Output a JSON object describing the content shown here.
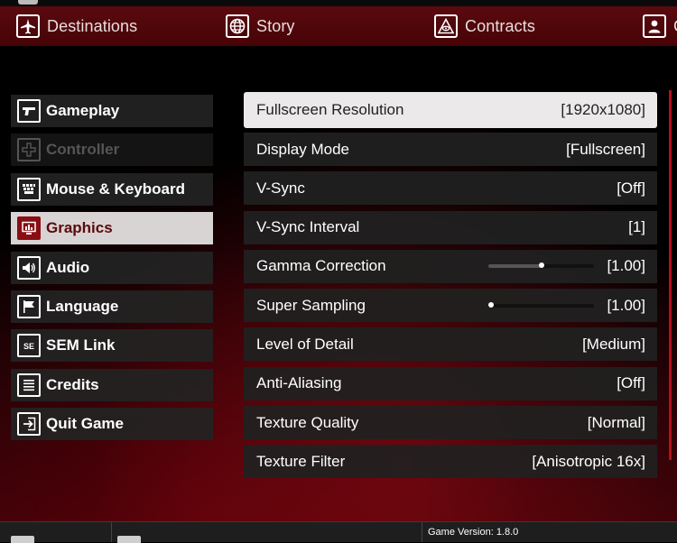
{
  "top_nav": [
    {
      "label": "Destinations",
      "icon": "airplane-icon"
    },
    {
      "label": "Story",
      "icon": "globe-icon"
    },
    {
      "label": "Contracts",
      "icon": "contracts-eye-icon"
    },
    {
      "label": "C",
      "icon": "profile-icon"
    }
  ],
  "menu": [
    {
      "label": "Gameplay",
      "icon": "pistol-icon",
      "state": "normal"
    },
    {
      "label": "Controller",
      "icon": "dpad-icon",
      "state": "disabled"
    },
    {
      "label": "Mouse & Keyboard",
      "icon": "keyboard-icon",
      "state": "normal"
    },
    {
      "label": "Graphics",
      "icon": "monitor-icon",
      "state": "active"
    },
    {
      "label": "Audio",
      "icon": "speaker-icon",
      "state": "normal"
    },
    {
      "label": "Language",
      "icon": "flag-icon",
      "state": "normal"
    },
    {
      "label": "SEM Link",
      "icon": "se-icon",
      "state": "normal"
    },
    {
      "label": "Credits",
      "icon": "list-icon",
      "state": "normal"
    },
    {
      "label": "Quit Game",
      "icon": "exit-icon",
      "state": "normal"
    }
  ],
  "settings": [
    {
      "name": "Fullscreen Resolution",
      "value": "[1920x1080]"
    },
    {
      "name": "Display Mode",
      "value": "[Fullscreen]"
    },
    {
      "name": "V-Sync",
      "value": "[Off]"
    },
    {
      "name": "V-Sync Interval",
      "value": "[1]"
    },
    {
      "name": "Gamma Correction",
      "value": "[1.00]",
      "slider_fraction": 0.5
    },
    {
      "name": "Super Sampling",
      "value": "[1.00]",
      "slider_fraction": 0.0
    },
    {
      "name": "Level of Detail",
      "value": "[Medium]"
    },
    {
      "name": "Anti-Aliasing",
      "value": "[Off]"
    },
    {
      "name": "Texture Quality",
      "value": "[Normal]"
    },
    {
      "name": "Texture Filter",
      "value": "[Anisotropic 16x]"
    }
  ],
  "footer": {
    "version": "Game Version: 1.8.0"
  },
  "colors": {
    "accent": "#8a0d14",
    "nav_bg": "#4f060a",
    "selected_row": "#ebe9e9",
    "scrollbar": "#b50f1a"
  }
}
